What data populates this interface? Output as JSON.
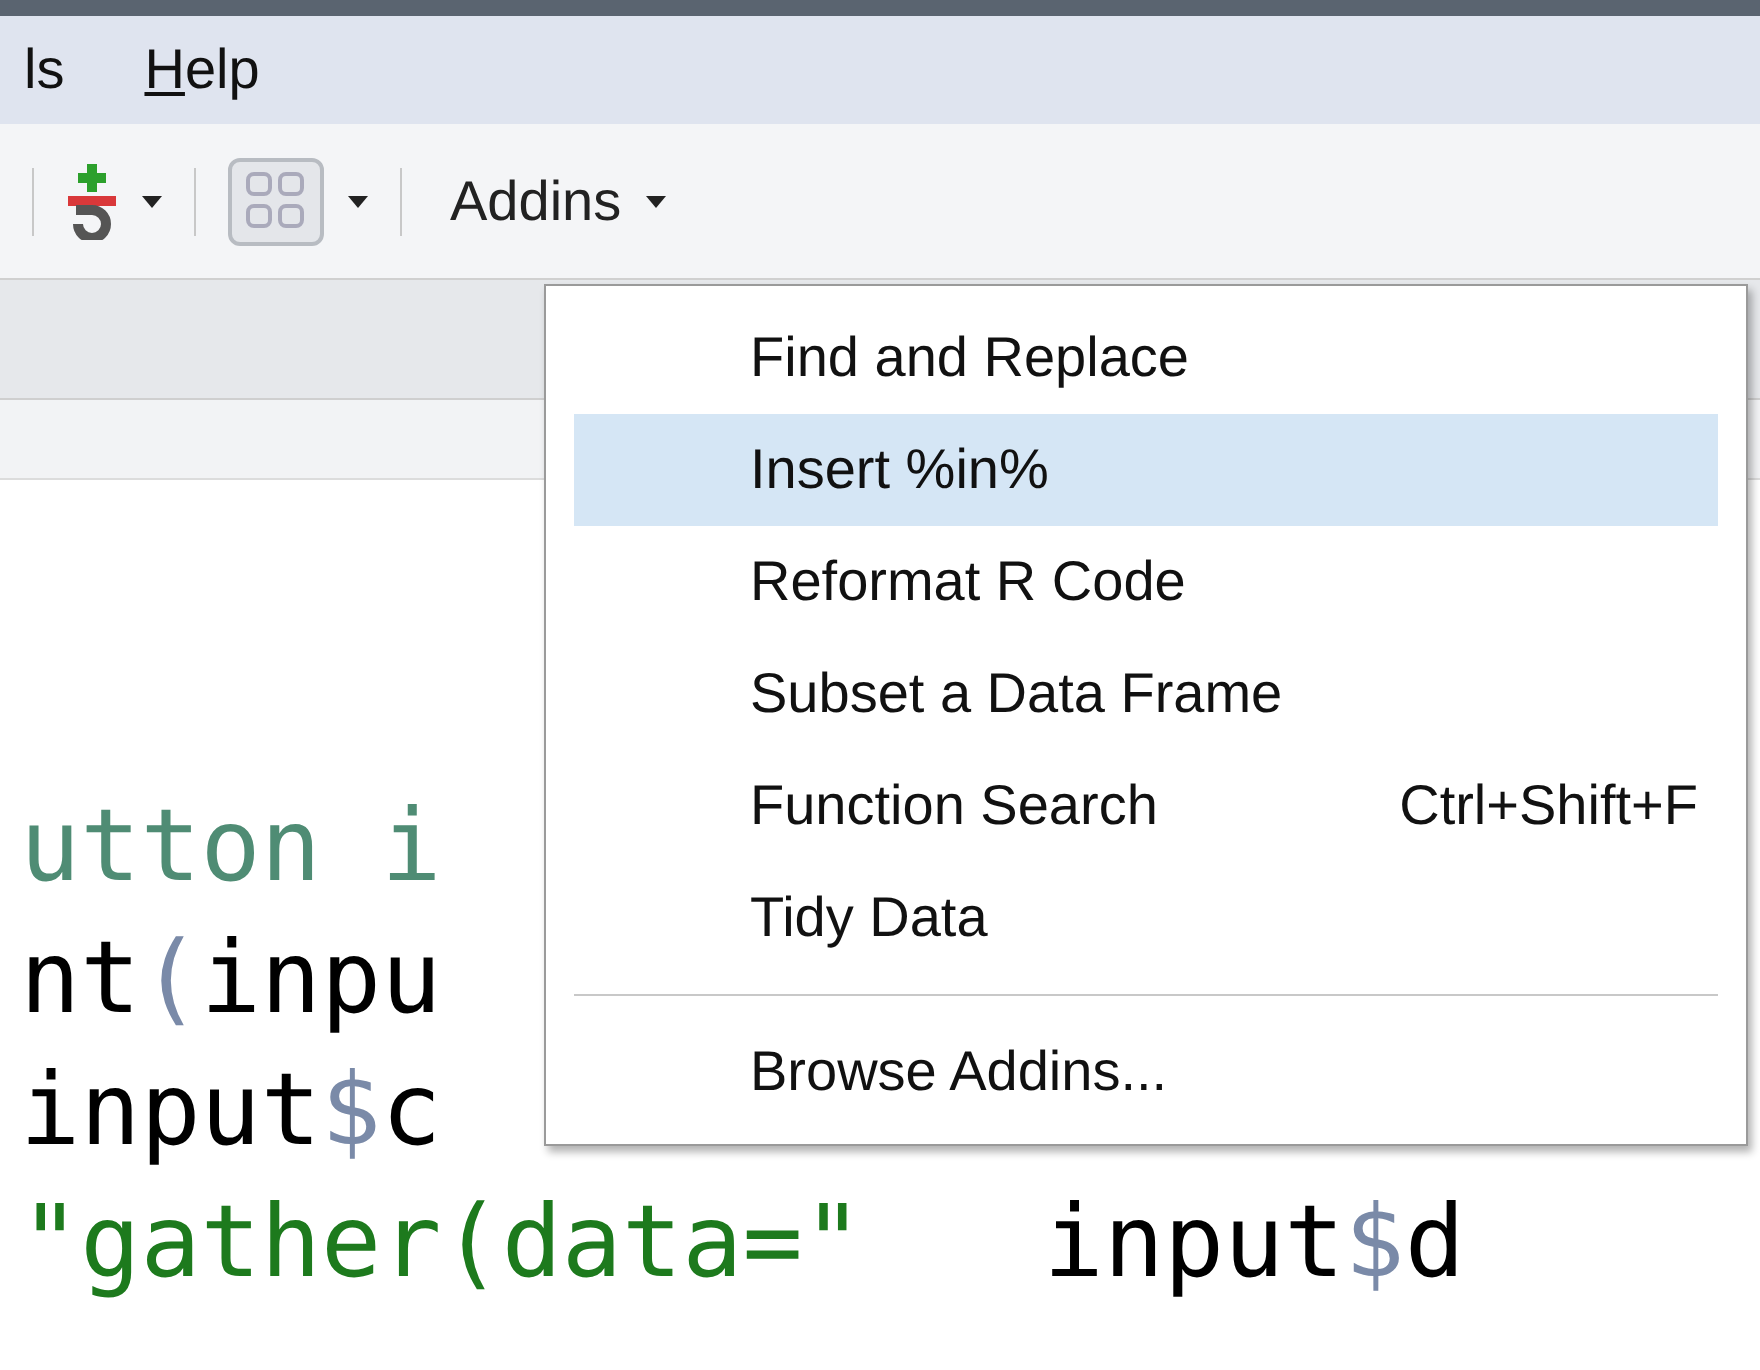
{
  "menu_bar": {
    "items": [
      {
        "label": "ls",
        "first_letter_underlined": false
      },
      {
        "label": "Help",
        "first_letter_underlined": true
      }
    ]
  },
  "toolbar": {
    "items": [
      {
        "kind": "separator"
      },
      {
        "kind": "insert-chunk"
      },
      {
        "kind": "caret"
      },
      {
        "kind": "separator"
      },
      {
        "kind": "grid"
      },
      {
        "kind": "caret"
      },
      {
        "kind": "separator"
      },
      {
        "kind": "menu",
        "label": "Addins"
      }
    ]
  },
  "editor": {
    "lines": [
      [
        {
          "text": "utton i",
          "kind": "comment"
        }
      ],
      [
        {
          "text": "nt",
          "kind": "plain"
        },
        {
          "text": "(",
          "kind": "punct"
        },
        {
          "text": "inpu",
          "kind": "plain"
        }
      ],
      [
        {
          "text": "input",
          "kind": "plain"
        },
        {
          "text": "$",
          "kind": "punct"
        },
        {
          "text": "c",
          "kind": "plain"
        }
      ],
      [
        {
          "text": "\"gather(data=\"",
          "kind": "string"
        },
        {
          "text": "   input",
          "kind": "plain"
        },
        {
          "text": "$",
          "kind": "punct"
        },
        {
          "text": "d",
          "kind": "plain"
        }
      ]
    ]
  },
  "addins_menu": {
    "items": [
      {
        "kind": "item",
        "label": "Find and Replace",
        "selected": false
      },
      {
        "kind": "item",
        "label": "Insert %in%",
        "selected": true
      },
      {
        "kind": "item",
        "label": "Reformat R Code",
        "selected": false
      },
      {
        "kind": "item",
        "label": "Subset a Data Frame",
        "selected": false
      },
      {
        "kind": "item",
        "label": "Function Search",
        "shortcut": "Ctrl+Shift+F",
        "selected": false
      },
      {
        "kind": "item",
        "label": "Tidy Data",
        "selected": false
      },
      {
        "kind": "separator"
      },
      {
        "kind": "item",
        "label": "Browse Addins...",
        "selected": false
      }
    ]
  }
}
